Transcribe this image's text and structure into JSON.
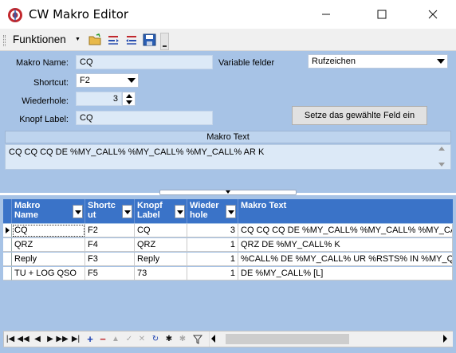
{
  "window": {
    "title": "CW Makro Editor",
    "controls": [
      "minimize",
      "maximize",
      "close"
    ]
  },
  "toolbar": {
    "menu_label": "Funktionen",
    "icons": [
      "open-folder-icon",
      "insert-field-icon",
      "remove-field-icon",
      "save-icon"
    ]
  },
  "form": {
    "makro_name_label": "Makro Name:",
    "makro_name_value": "CQ",
    "shortcut_label": "Shortcut:",
    "shortcut_value": "F2",
    "wiederhole_label": "Wiederhole:",
    "wiederhole_value": "3",
    "knopf_label_label": "Knopf Label:",
    "knopf_label_value": "CQ",
    "variable_felder_label": "Variable felder",
    "variable_felder_value": "Rufzeichen",
    "setze_button": "Setze das gewählte Feld ein",
    "makro_text_header": "Makro Text",
    "makro_text_value": "CQ CQ CQ DE  %MY_CALL% %MY_CALL% %MY_CALL% AR K"
  },
  "grid": {
    "columns": [
      {
        "line1": "Makro",
        "line2": "Name"
      },
      {
        "line1": "Shortc",
        "line2": "ut"
      },
      {
        "line1": "Knopf",
        "line2": "Label"
      },
      {
        "line1": "Wieder",
        "line2": "hole"
      },
      {
        "line1": "Makro Text",
        "line2": ""
      }
    ],
    "rows": [
      {
        "name": "CQ",
        "shortcut": "F2",
        "label": "CQ",
        "repeat": "3",
        "text": "CQ CQ CQ DE  %MY_CALL% %MY_CALL% %MY_CALL"
      },
      {
        "name": "QRZ",
        "shortcut": "F4",
        "label": "QRZ",
        "repeat": "1",
        "text": "QRZ DE %MY_CALL% K"
      },
      {
        "name": "Reply",
        "shortcut": "F3",
        "label": "Reply",
        "repeat": "1",
        "text": "%CALL% DE %MY_CALL% UR %RSTS% IN %MY_QTH"
      },
      {
        "name": "TU + LOG QSO",
        "shortcut": "F5",
        "label": "73",
        "repeat": "1",
        "text": "DE %MY_CALL% [L]"
      }
    ]
  },
  "navigator": {
    "buttons": [
      "first-icon",
      "prev-page-icon",
      "prev-icon",
      "next-icon",
      "next-page-icon",
      "last-icon",
      "add-icon",
      "delete-icon",
      "edit-icon",
      "post-icon",
      "cancel-icon",
      "refresh-icon",
      "apply-icon",
      "cancel-filter-icon",
      "filter-icon"
    ]
  },
  "colors": {
    "panel": "#a7c3e6",
    "grid_header": "#3a73c8",
    "field": "#dce9f7"
  }
}
